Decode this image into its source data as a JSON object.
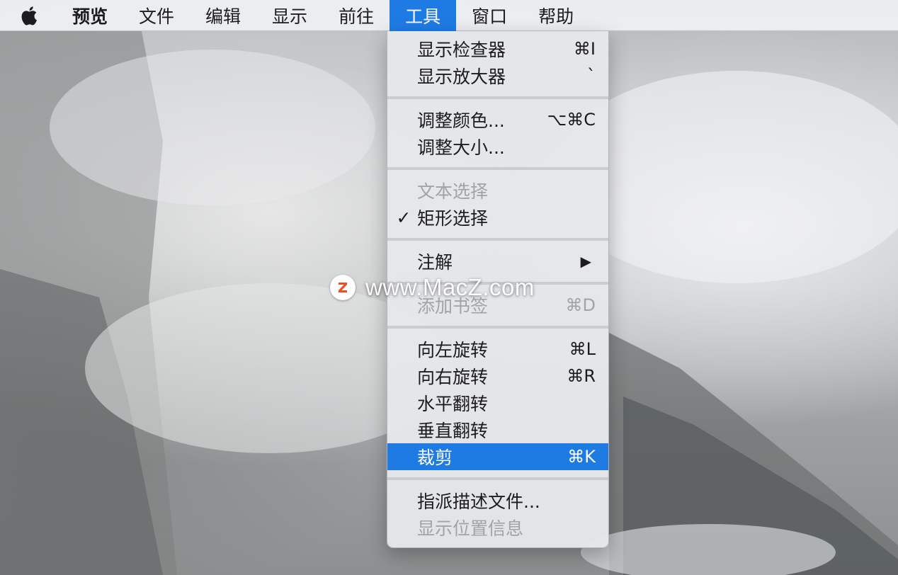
{
  "menubar": {
    "apple_icon": "apple-logo-icon",
    "app_name": "预览",
    "menus": [
      "文件",
      "编辑",
      "显示",
      "前往",
      "工具",
      "窗口",
      "帮助"
    ],
    "active_menu": "工具"
  },
  "tools_menu": {
    "groups": [
      [
        {
          "label": "显示检查器",
          "shortcut": "⌘I",
          "enabled": true
        },
        {
          "label": "显示放大器",
          "shortcut": "`",
          "enabled": true
        }
      ],
      [
        {
          "label": "调整颜色...",
          "shortcut": "⌥⌘C",
          "enabled": true
        },
        {
          "label": "调整大小...",
          "shortcut": "",
          "enabled": true
        }
      ],
      [
        {
          "label": "文本选择",
          "shortcut": "",
          "enabled": false
        },
        {
          "label": "矩形选择",
          "shortcut": "",
          "enabled": true,
          "checked": true
        }
      ],
      [
        {
          "label": "注解",
          "shortcut": "",
          "enabled": true,
          "submenu": true
        }
      ],
      [
        {
          "label": "添加书签",
          "shortcut": "⌘D",
          "enabled": false
        }
      ],
      [
        {
          "label": "向左旋转",
          "shortcut": "⌘L",
          "enabled": true
        },
        {
          "label": "向右旋转",
          "shortcut": "⌘R",
          "enabled": true
        },
        {
          "label": "水平翻转",
          "shortcut": "",
          "enabled": true
        },
        {
          "label": "垂直翻转",
          "shortcut": "",
          "enabled": true
        },
        {
          "label": "裁剪",
          "shortcut": "⌘K",
          "enabled": true,
          "highlighted": true
        }
      ],
      [
        {
          "label": "指派描述文件...",
          "shortcut": "",
          "enabled": true
        },
        {
          "label": "显示位置信息",
          "shortcut": "",
          "enabled": false
        }
      ]
    ],
    "check_mark": "✓",
    "submenu_arrow": "▶"
  },
  "watermark": {
    "logo_letter": "Z",
    "text": "www.MacZ.com"
  },
  "colors": {
    "highlight": "#1f7be4",
    "disabled_text": "#a1a3a7",
    "watermark_logo": "#e8502a"
  }
}
